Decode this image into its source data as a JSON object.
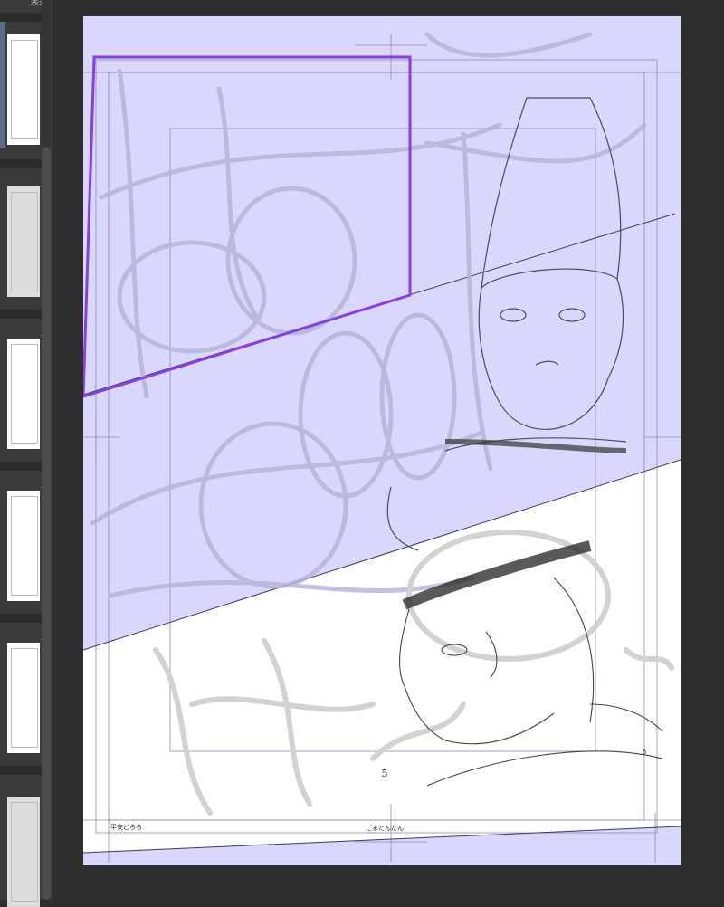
{
  "sidebar": {
    "label": "表示",
    "page_count_visible": 6
  },
  "canvas": {
    "page_number_center": "5",
    "page_number_side": "5",
    "footer_left": "平安どろろ",
    "footer_center": "ごまたんたん",
    "colors": {
      "selection_overlay": "#d9d7fb",
      "selection_border": "#8a3ee0",
      "background": "#2e2e2e"
    }
  }
}
